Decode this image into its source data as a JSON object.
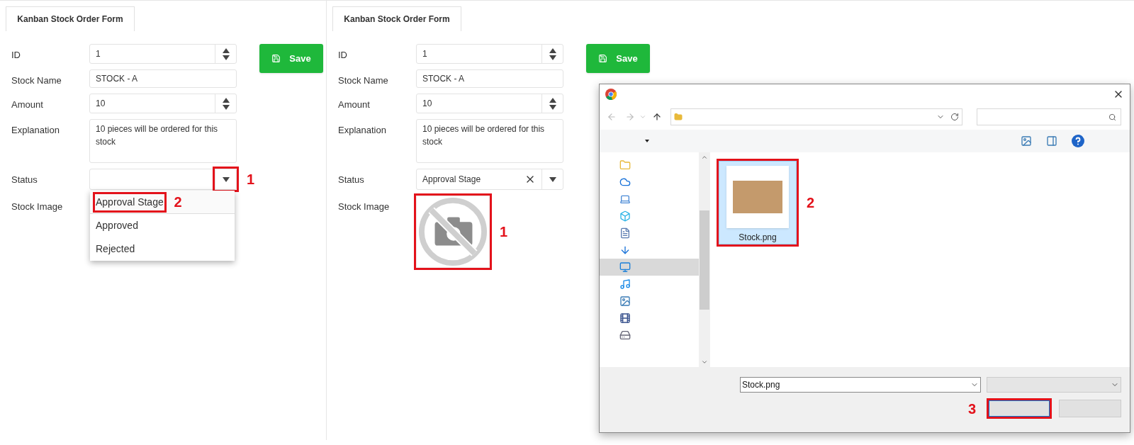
{
  "panels": [
    {
      "tab": {
        "label": "Kanban Stock Order Form",
        "selected": true
      },
      "save_button": "Save",
      "fields": [
        {
          "kind": "spinner",
          "label": "ID",
          "value": "1"
        },
        {
          "kind": "text",
          "label": "Stock Name",
          "value": "STOCK - A"
        },
        {
          "kind": "spinner",
          "label": "Amount",
          "value": "10"
        },
        {
          "kind": "textarea",
          "label": "Explanation",
          "value": "10 pieces will be ordered for this stock"
        },
        {
          "kind": "select",
          "label": "Status",
          "clearable": false,
          "open": true,
          "arrow_callout": "1",
          "options": [
            {
              "label": "Approval Stage",
              "selected": true,
              "callout": "2"
            },
            {
              "label": "Approved",
              "selected": false
            },
            {
              "label": "Rejected",
              "selected": false
            }
          ]
        },
        {
          "kind": "image",
          "label": "Stock Image"
        }
      ]
    },
    {
      "tab": {
        "label": "Kanban Stock Order Form",
        "selected": true
      },
      "save_button": "Save",
      "fields": [
        {
          "kind": "spinner",
          "label": "ID",
          "value": "1"
        },
        {
          "kind": "text",
          "label": "Stock Name",
          "value": "STOCK - A"
        },
        {
          "kind": "spinner",
          "label": "Amount",
          "value": "10"
        },
        {
          "kind": "textarea",
          "label": "Explanation",
          "value": "10 pieces will be ordered for this stock"
        },
        {
          "kind": "select",
          "label": "Status",
          "value": "Approval Stage",
          "clearable": true,
          "open": false
        },
        {
          "kind": "image",
          "label": "Stock Image",
          "placeholder_shown": true,
          "callout": "1"
        }
      ]
    }
  ],
  "file_dialog": {
    "nav_items": [
      {
        "kind": "folder",
        "selected": false
      },
      {
        "kind": "cloud",
        "selected": false
      },
      {
        "kind": "computer",
        "selected": false
      },
      {
        "kind": "cube",
        "selected": false
      },
      {
        "kind": "document",
        "selected": false
      },
      {
        "kind": "download",
        "selected": false
      },
      {
        "kind": "desktop",
        "selected": true
      },
      {
        "kind": "music",
        "selected": false
      },
      {
        "kind": "pictures",
        "selected": false
      },
      {
        "kind": "videos",
        "selected": false
      },
      {
        "kind": "drive",
        "selected": false
      }
    ],
    "files": [
      {
        "name": "Stock.png",
        "selected": true,
        "callout": "2"
      }
    ],
    "file_name": "Stock.png",
    "buttons": [
      {
        "focused": true,
        "callout": "3"
      },
      {
        "focused": false
      }
    ]
  }
}
